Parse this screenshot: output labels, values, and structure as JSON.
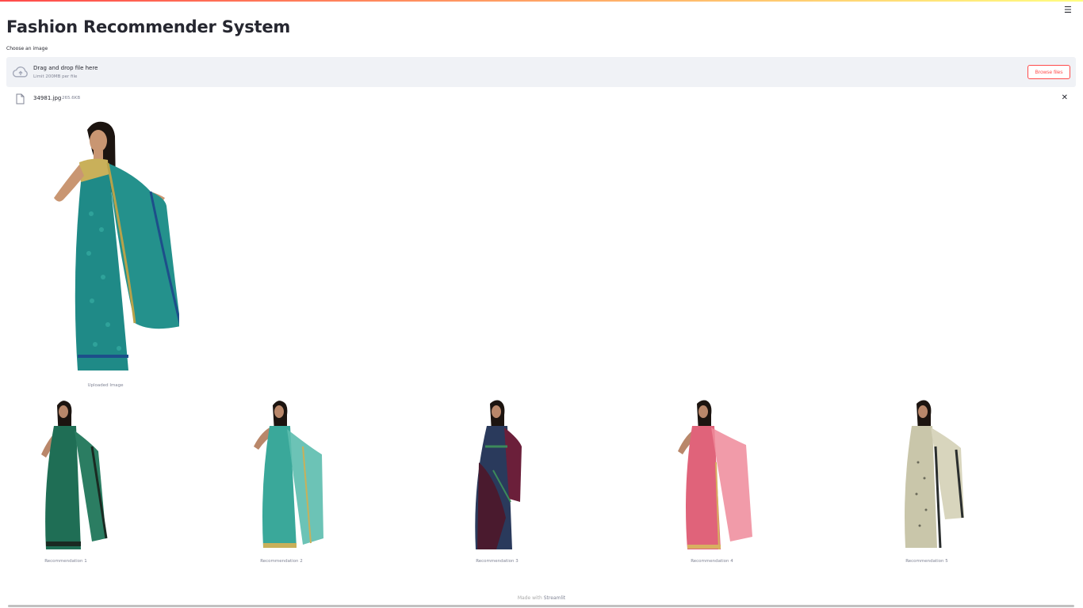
{
  "app": {
    "title": "Fashion Recommender System",
    "menu_icon": "hamburger-menu-icon"
  },
  "uploader": {
    "label": "Choose an image",
    "drop_title": "Drag and drop file here",
    "limit_text": "Limit 200MB per file",
    "browse_label": "Browse files",
    "icon": "cloud-upload-icon"
  },
  "file": {
    "name": "34981.jpg",
    "size": "265.6KB",
    "icon": "file-icon",
    "remove_icon": "close-icon"
  },
  "uploaded": {
    "caption": "Uploaded Image",
    "saree_color": "#1f8a87"
  },
  "recommendations": [
    {
      "caption": "Recommendation 1",
      "color": "#1f6e55"
    },
    {
      "caption": "Recommendation 2",
      "color": "#3aa89a"
    },
    {
      "caption": "Recommendation 3",
      "color": "#2a3a5c"
    },
    {
      "caption": "Recommendation 4",
      "color": "#e0637a"
    },
    {
      "caption": "Recommendation 5",
      "color": "#c9c6aa"
    }
  ],
  "footer": {
    "prefix": "Made with",
    "brand": "Streamlit"
  },
  "colors": {
    "accent": "#ff4b4b",
    "dropzone_bg": "#f0f2f6",
    "text": "#262730",
    "muted": "#808495"
  }
}
